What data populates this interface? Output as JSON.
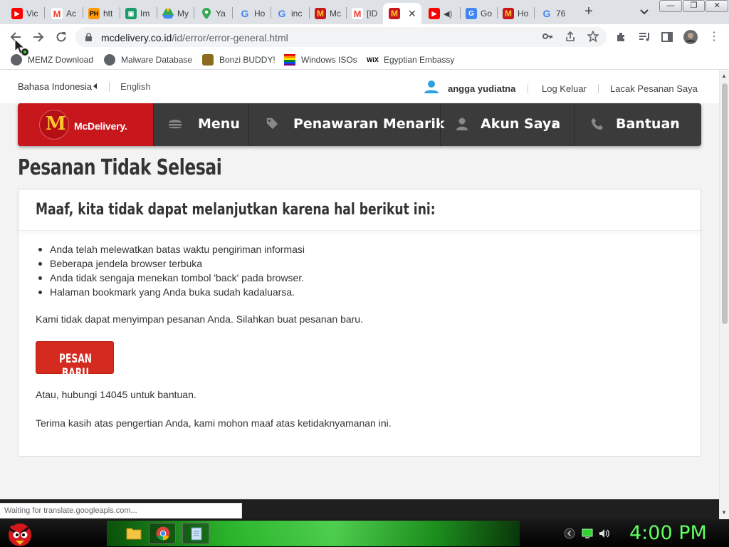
{
  "browser": {
    "tabs": [
      {
        "title": "Vic",
        "icon": "youtube-icon",
        "color": "#ff0000"
      },
      {
        "title": "Ac",
        "icon": "gmail-icon",
        "color": "#ea4335"
      },
      {
        "title": "htt",
        "icon": "ph-icon",
        "color": "#ff9900"
      },
      {
        "title": "Im",
        "icon": "image-icon",
        "color": "#1a9c6b"
      },
      {
        "title": "My",
        "icon": "drive-icon",
        "color": "#34a853"
      },
      {
        "title": "Ya",
        "icon": "maps-icon",
        "color": "#1a73e8"
      },
      {
        "title": "Ho",
        "icon": "google-icon",
        "color": "#4285f4"
      },
      {
        "title": "inc",
        "icon": "google-icon",
        "color": "#4285f4"
      },
      {
        "title": "Mc",
        "icon": "mcdonalds-icon",
        "color": "#c8161d"
      },
      {
        "title": "[ID",
        "icon": "gmail-icon",
        "color": "#ea4335"
      },
      {
        "title": "",
        "icon": "mcdonalds-icon",
        "color": "#c8161d",
        "active": true
      },
      {
        "title": "",
        "icon": "youtube-icon",
        "color": "#ff0000"
      },
      {
        "title": "Go",
        "icon": "translate-icon",
        "color": "#4285f4"
      },
      {
        "title": "Ho",
        "icon": "mcdonalds-icon",
        "color": "#c8161d"
      },
      {
        "title": "76",
        "icon": "google-icon",
        "color": "#4285f4"
      }
    ],
    "url_host": "mcdelivery.co.id",
    "url_path": "/id/error/error-general.html"
  },
  "bookmarks": [
    {
      "label": "MEMZ Download",
      "icon": "globe-icon"
    },
    {
      "label": "Malware Database",
      "icon": "globe-icon"
    },
    {
      "label": "Bonzi BUDDY!",
      "icon": "bonzi-icon"
    },
    {
      "label": "Windows ISOs",
      "icon": "windows-icon"
    },
    {
      "label": "Egyptian Embassy",
      "icon": "wix-icon"
    }
  ],
  "site": {
    "lang_id": "Bahasa Indonesia",
    "lang_en": "English",
    "username": "angga yudiatna",
    "logout": "Log Keluar",
    "track": "Lacak Pesanan Saya",
    "logo_text": "McDelivery.",
    "nav": {
      "menu": "Menu",
      "offers": "Penawaran Menarik",
      "account": "Akun Saya",
      "help": "Bantuan"
    },
    "page_title": "Pesanan Tidak Selesai",
    "card_title": "Maaf, kita tidak dapat melanjutkan karena hal berikut ini:",
    "reasons": [
      "Anda telah melewatkan batas waktu pengiriman informasi",
      "Beberapa jendela browser terbuka",
      "Anda tidak sengaja menekan tombol 'back' pada browser.",
      "Halaman bookmark yang Anda buka sudah kadaluarsa."
    ],
    "cannot_save": "Kami tidak dapat menyimpan pesanan Anda. Silahkan buat pesanan baru.",
    "new_order_button": "PESAN BARU",
    "contact": "Atau, hubungi 14045 untuk bantuan.",
    "thanks": "Terima kasih atas pengertian Anda, kami mohon maaf atas ketidaknyamanan ini.",
    "brand_red": "#c8161d",
    "brand_yellow": "#ffc72c"
  },
  "status": {
    "text": "Waiting for translate.googleapis.com..."
  },
  "taskbar": {
    "clock": "4:00 PM"
  }
}
